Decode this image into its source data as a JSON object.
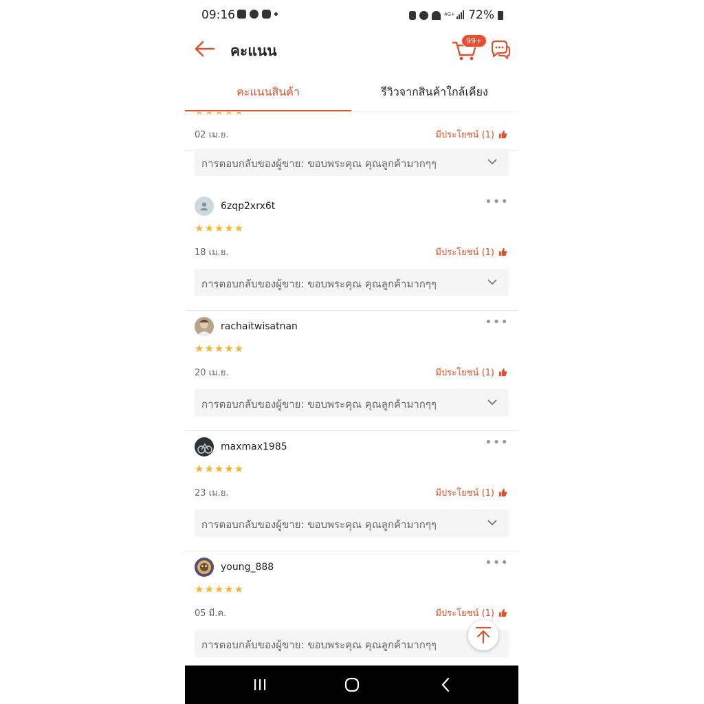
{
  "status_bar": {
    "time": "09:16",
    "battery": "72%"
  },
  "header": {
    "title": "คะแนน",
    "cart_badge": "99+"
  },
  "tabs": [
    {
      "label": "คะแนนสินค้า",
      "active": true
    },
    {
      "label": "รีวิวจากสินค้าใกล้เคียง",
      "active": false
    }
  ],
  "reviews": [
    {
      "username": "",
      "stars": "★★★★★",
      "date": "02 เม.ย.",
      "helpful": "มีประโยชน์ (1)",
      "seller_reply": "การตอบกลับของผู้ขาย: ขอบพระคุณ  คุณลูกค้ามากๆๆ"
    },
    {
      "username": "6zqp2xrx6t",
      "stars": "★★★★★",
      "date": "18 เม.ย.",
      "helpful": "มีประโยชน์ (1)",
      "seller_reply": "การตอบกลับของผู้ขาย: ขอบพระคุณ  คุณลูกค้ามากๆๆ"
    },
    {
      "username": "rachaitwisatnan",
      "stars": "★★★★★",
      "date": "20 เม.ย.",
      "helpful": "มีประโยชน์ (1)",
      "seller_reply": "การตอบกลับของผู้ขาย: ขอบพระคุณ  คุณลูกค้ามากๆๆ"
    },
    {
      "username": "maxmax1985",
      "stars": "★★★★★",
      "date": "23 เม.ย.",
      "helpful": "มีประโยชน์ (1)",
      "seller_reply": "การตอบกลับของผู้ขาย: ขอบพระคุณ  คุณลูกค้ามากๆๆ"
    },
    {
      "username": "young_888",
      "stars": "★★★★★",
      "date": "05 มี.ค.",
      "helpful": "มีประโยชน์ (1)",
      "seller_reply": "การตอบกลับของผู้ขาย: ขอบพระคุณ  คุณลูกค้ามากๆๆ"
    }
  ],
  "icons": {
    "back": "arrow-left-icon",
    "cart": "cart-icon",
    "chat": "chat-icon",
    "thumb": "thumbs-up-icon",
    "chevron": "chevron-down-icon",
    "scroll_top": "arrow-up-icon"
  },
  "colors": {
    "accent": "#d9532e",
    "star": "#f6b52b",
    "reply_bg": "#f5f5f5"
  }
}
